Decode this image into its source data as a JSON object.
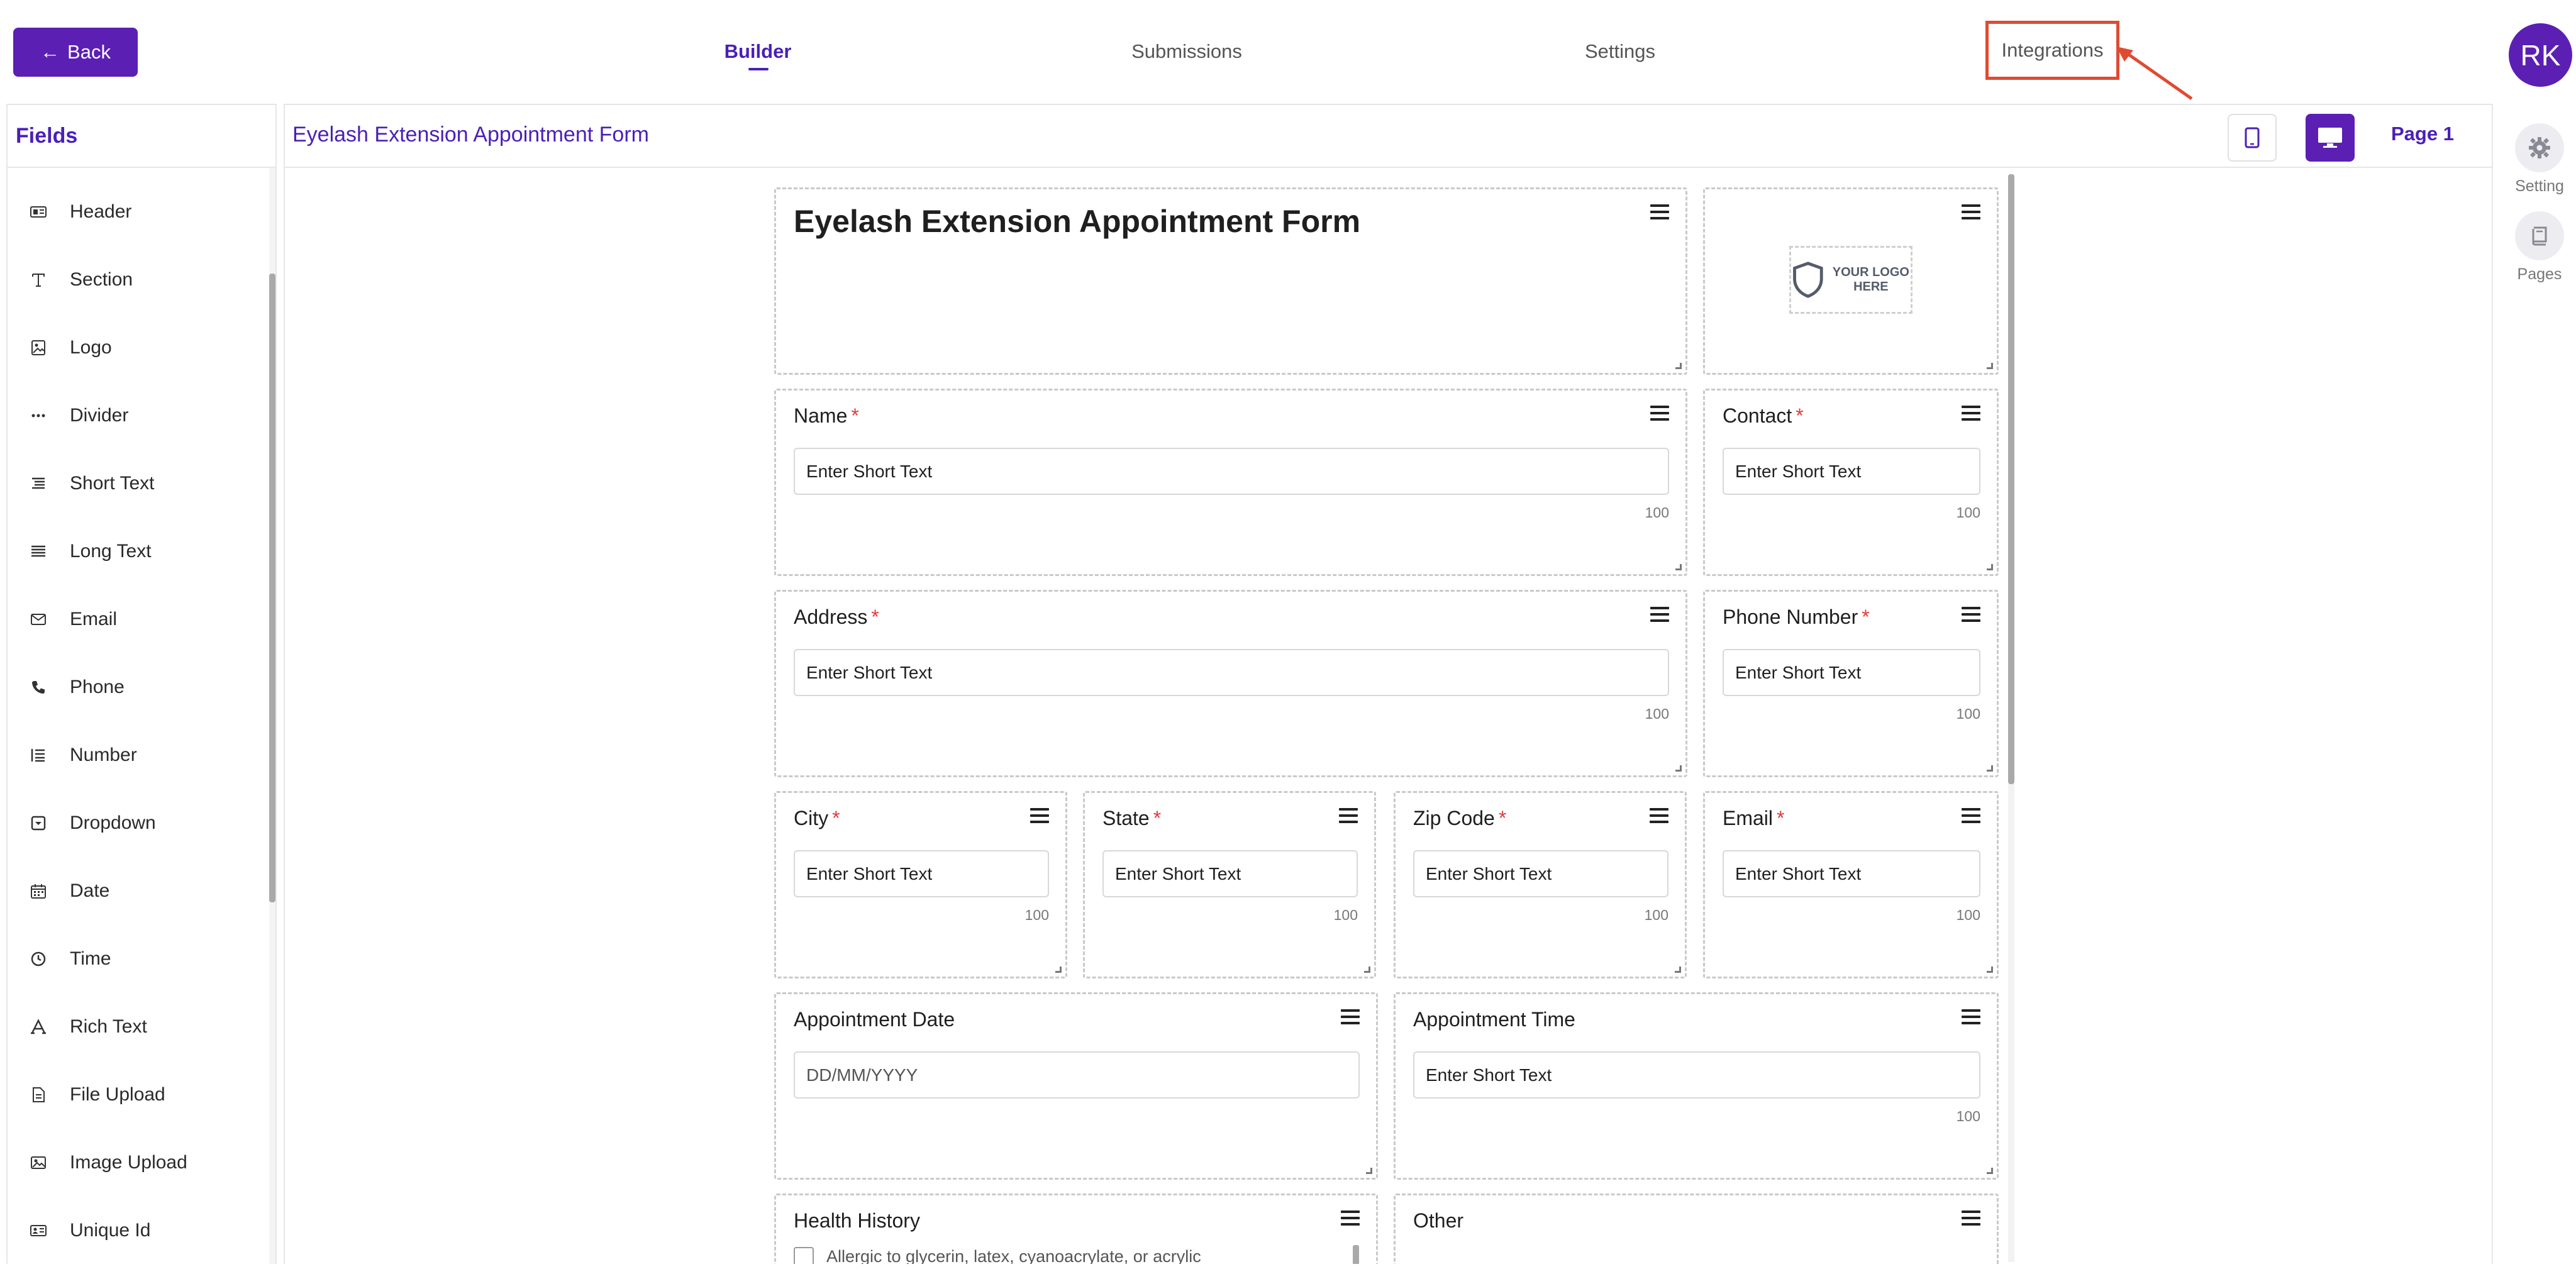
{
  "topbar": {
    "back_label": "Back",
    "tabs": {
      "builder": "Builder",
      "submissions": "Submissions",
      "settings": "Settings",
      "integrations": "Integrations"
    },
    "active_tab": "Builder",
    "avatar_initials": "RK"
  },
  "colors": {
    "brand": "#5b1fb3",
    "accent_text": "#4a1fb8",
    "annotation": "#e04a32",
    "required": "#e23b3b"
  },
  "fields_panel": {
    "title": "Fields",
    "items": [
      {
        "label": "Header",
        "icon": "header-icon"
      },
      {
        "label": "Section",
        "icon": "text-icon"
      },
      {
        "label": "Logo",
        "icon": "image-icon"
      },
      {
        "label": "Divider",
        "icon": "ellipsis-icon"
      },
      {
        "label": "Short Text",
        "icon": "short-text-icon"
      },
      {
        "label": "Long Text",
        "icon": "long-text-icon"
      },
      {
        "label": "Email",
        "icon": "envelope-icon"
      },
      {
        "label": "Phone",
        "icon": "phone-icon"
      },
      {
        "label": "Number",
        "icon": "numbered-list-icon"
      },
      {
        "label": "Dropdown",
        "icon": "dropdown-icon"
      },
      {
        "label": "Date",
        "icon": "calendar-icon"
      },
      {
        "label": "Time",
        "icon": "clock-icon"
      },
      {
        "label": "Rich Text",
        "icon": "font-icon"
      },
      {
        "label": "File Upload",
        "icon": "file-icon"
      },
      {
        "label": "Image Upload",
        "icon": "image-upload-icon"
      },
      {
        "label": "Unique Id",
        "icon": "id-card-icon"
      }
    ]
  },
  "canvas": {
    "title": "Eyelash Extension Appointment Form",
    "page_label": "Page 1"
  },
  "form": {
    "title": "Eyelash Extension Appointment Form",
    "logo_text": "YOUR LOGO HERE",
    "placeholder_short": "Enter Short Text",
    "placeholder_date": "DD/MM/YYYY",
    "char_limit": "100",
    "required_mark": "*",
    "fields": {
      "name": "Name",
      "contact": "Contact",
      "address": "Address",
      "phone": "Phone Number",
      "city": "City",
      "state": "State",
      "zip": "Zip Code",
      "email": "Email",
      "appt_date": "Appointment Date",
      "appt_time": "Appointment Time",
      "health": "Health History",
      "other": "Other"
    },
    "health_option": "Allergic to glycerin, latex, cyanoacrylate, or acrylic"
  },
  "rail": {
    "setting": "Setting",
    "pages": "Pages"
  }
}
